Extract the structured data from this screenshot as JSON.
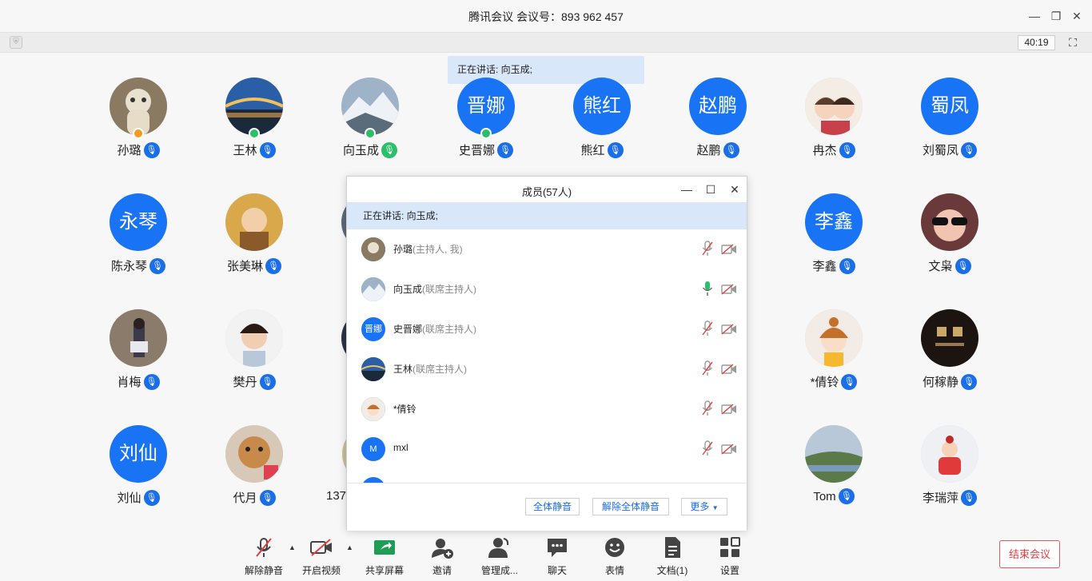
{
  "window": {
    "title": "腾讯会议 会议号：893 962 457",
    "timer": "40:19"
  },
  "speaking": {
    "text": "正在讲话: 向玉成;"
  },
  "grid": [
    {
      "name": "孙璐",
      "avatar_text": "",
      "photo": true,
      "badge": "orange",
      "mic": "blue"
    },
    {
      "name": "王林",
      "avatar_text": "",
      "photo": true,
      "badge": "green",
      "mic": "blue"
    },
    {
      "name": "向玉成",
      "avatar_text": "",
      "photo": true,
      "badge": "green",
      "mic": "green"
    },
    {
      "name": "史晋娜",
      "avatar_text": "晋娜",
      "photo": false,
      "badge": "green",
      "mic": "blue"
    },
    {
      "name": "熊红",
      "avatar_text": "熊红",
      "photo": false,
      "badge": "",
      "mic": "blue"
    },
    {
      "name": "赵鹏",
      "avatar_text": "赵鹏",
      "photo": false,
      "badge": "",
      "mic": "blue"
    },
    {
      "name": "冉杰",
      "avatar_text": "",
      "photo": true,
      "badge": "",
      "mic": "blue"
    },
    {
      "name": "刘蜀凤",
      "avatar_text": "蜀凤",
      "photo": false,
      "badge": "",
      "mic": "blue"
    },
    {
      "name": "陈永琴",
      "avatar_text": "永琴",
      "photo": false,
      "badge": "",
      "mic": "blue"
    },
    {
      "name": "张美琳",
      "avatar_text": "",
      "photo": true,
      "badge": "",
      "mic": "blue"
    },
    {
      "name": "李鑫",
      "avatar_text": "李鑫",
      "photo": false,
      "badge": "",
      "mic": "blue"
    },
    {
      "name": "文枭",
      "avatar_text": "",
      "photo": true,
      "badge": "",
      "mic": "blue"
    },
    {
      "name": "肖梅",
      "avatar_text": "",
      "photo": true,
      "badge": "",
      "mic": "blue"
    },
    {
      "name": "樊丹",
      "avatar_text": "",
      "photo": true,
      "badge": "",
      "mic": "blue"
    },
    {
      "name": "*倩铃",
      "avatar_text": "",
      "photo": true,
      "badge": "",
      "mic": "blue"
    },
    {
      "name": "何稼静",
      "avatar_text": "",
      "photo": true,
      "badge": "",
      "mic": "blue"
    },
    {
      "name": "刘仙",
      "avatar_text": "刘仙",
      "photo": false,
      "badge": "",
      "mic": "blue"
    },
    {
      "name": "代月",
      "avatar_text": "",
      "photo": true,
      "badge": "",
      "mic": "blue"
    },
    {
      "name": "137",
      "avatar_text": "",
      "photo": true,
      "badge": "",
      "mic": ""
    },
    {
      "name": "Tom",
      "avatar_text": "",
      "photo": true,
      "badge": "",
      "mic": "blue"
    },
    {
      "name": "李瑞萍",
      "avatar_text": "",
      "photo": true,
      "badge": "",
      "mic": "blue"
    }
  ],
  "members_panel": {
    "title": "成员(57人)",
    "speaking": "正在讲话: 向玉成;",
    "members": [
      {
        "name": "孙璐",
        "role": "(主持人, 我)",
        "avatar_text": "",
        "photo": true,
        "mic_state": "muted"
      },
      {
        "name": "向玉成",
        "role": "(联席主持人)",
        "avatar_text": "",
        "photo": true,
        "mic_state": "speaking"
      },
      {
        "name": "史晋娜",
        "role": "(联席主持人)",
        "avatar_text": "晋娜",
        "photo": false,
        "mic_state": "muted"
      },
      {
        "name": "王林",
        "role": "(联席主持人)",
        "avatar_text": "",
        "photo": true,
        "mic_state": "muted"
      },
      {
        "name": "*倩铃",
        "role": "",
        "avatar_text": "",
        "photo": true,
        "mic_state": "muted"
      },
      {
        "name": "mxl",
        "role": "",
        "avatar_text": "M",
        "photo": false,
        "mic_state": "muted"
      }
    ],
    "mute_all": "全体静音",
    "unmute_all": "解除全体静音",
    "more": "更多"
  },
  "toolbar": {
    "items": [
      {
        "label": "解除静音",
        "icon": "mic-muted-icon"
      },
      {
        "label": "开启视频",
        "icon": "camera-off-icon"
      },
      {
        "label": "共享屏幕",
        "icon": "share-screen-icon"
      },
      {
        "label": "邀请",
        "icon": "invite-icon"
      },
      {
        "label": "管理成...",
        "icon": "members-icon"
      },
      {
        "label": "聊天",
        "icon": "chat-icon"
      },
      {
        "label": "表情",
        "icon": "emoji-icon"
      },
      {
        "label": "文档(1)",
        "icon": "document-icon"
      },
      {
        "label": "设置",
        "icon": "settings-icon"
      }
    ],
    "end_meeting": "结束会议"
  },
  "colors": {
    "accent": "#1a6ee8",
    "avatar_blue": "#1973f5",
    "speaking_bg": "#d9e7fb",
    "danger": "#e04040",
    "active_green": "#2bbf6a"
  }
}
